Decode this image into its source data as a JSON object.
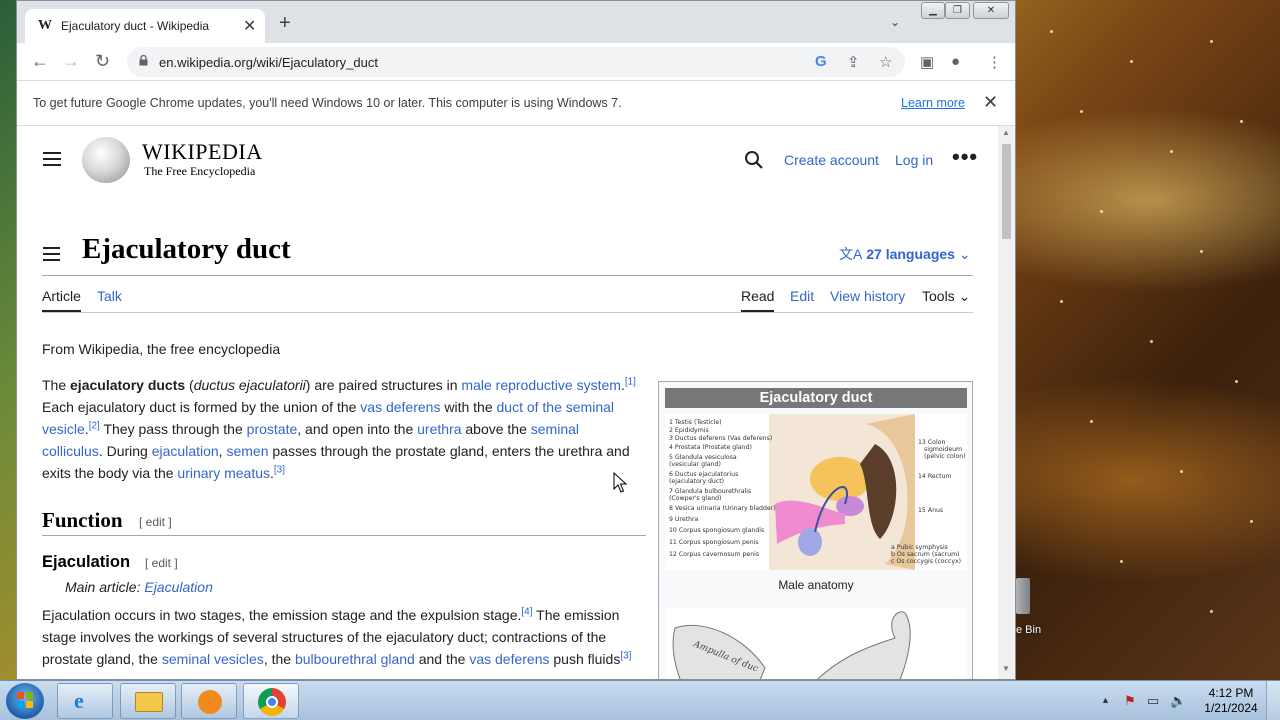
{
  "browser": {
    "tab_title": "Ejaculatory duct - Wikipedia",
    "tab_favicon": "W",
    "tab_close": "✕",
    "new_tab": "+",
    "url": "en.wikipedia.org/wiki/Ejaculatory_duct",
    "infobar_text": "To get future Google Chrome updates, you'll need Windows 10 or later. This computer is using Windows 7.",
    "infobar_link": "Learn more",
    "infobar_close": "✕"
  },
  "header": {
    "wordmark": "WIKIPEDIA",
    "tagline": "The Free Encyclopedia",
    "create_account": "Create account",
    "log_in": "Log in",
    "more": "•••"
  },
  "article": {
    "title": "Ejaculatory duct",
    "languages": "27 languages",
    "tabs": {
      "article": "Article",
      "talk": "Talk",
      "read": "Read",
      "edit": "Edit",
      "view_history": "View history",
      "tools": "Tools"
    },
    "from": "From Wikipedia, the free encyclopedia",
    "p1": {
      "t1": "The ",
      "b1": "ejaculatory ducts",
      "t2": " (",
      "i1": "ductus ejaculatorii",
      "t3": ") are paired structures in ",
      "l1": "male reproductive system",
      "t4": ".",
      "s1": "[1]",
      "t5": " Each ejaculatory duct is formed by the union of the ",
      "l2": "vas deferens",
      "t6": " with the ",
      "l3": "duct of the seminal vesicle",
      "t7": ".",
      "s2": "[2]",
      "t8": " They pass through the ",
      "l4": "prostate",
      "t9": ", and open into the ",
      "l5": "urethra",
      "t10": " above the ",
      "l6": "seminal colliculus",
      "t11": ". During ",
      "l7": "ejaculation",
      "t12": ", ",
      "l8": "semen",
      "t13": " passes through the prostate gland, enters the urethra and exits the body via the ",
      "l9": "urinary meatus",
      "t14": ".",
      "s3": "[3]"
    },
    "h2": "Function",
    "h2_edit": "[ edit ]",
    "h3": "Ejaculation",
    "h3_edit": "[ edit ]",
    "hatnote_prefix": "Main article: ",
    "hatnote_link": "Ejaculation",
    "p2": {
      "t1": "Ejaculation occurs in two stages, the emission stage and the expulsion stage.",
      "s1": "[4]",
      "t2": " The emission stage involves the workings of several structures of the ejaculatory duct; contractions of the prostate gland, the ",
      "l1": "seminal vesicles",
      "t3": ", the ",
      "l2": "bulbourethral gland",
      "t4": " and the ",
      "l3": "vas deferens",
      "t5": " push fluids",
      "s2": "[3]"
    }
  },
  "infobox": {
    "title": "Ejaculatory duct",
    "caption": "Male anatomy",
    "image_legend": [
      "1  Testis (Testicle)",
      "2  Epididymis",
      "3  Ductus deferens (Vas deferens)",
      "4  Prostata (Prostate gland)",
      "5  Glandula vesiculosa",
      "   (vesicular gland)",
      "6  Ductus ejaculatorius",
      "   (ejaculatory duct)",
      "7  Glandula bulbourethralis",
      "   (Cowper's gland)",
      "8  Vesica urinaria (Urinary bladder)",
      "9  Urethra",
      "10 Corpus spongiosum glandis",
      "11 Corpus spongiosum penis",
      "12 Corpus cavernosum penis"
    ],
    "image_right": [
      "13 Colon",
      "sigmoideum",
      "(pelvic colon)",
      "14 Rectum",
      "15 Anus",
      "a  Pubic symphysis",
      "b  Os sacrum (sacrum)",
      "c  Os coccygis (coccyx)"
    ],
    "sketch_text": "Ampulla of duc"
  },
  "desktop": {
    "recycle_label": "e Bin"
  },
  "taskbar": {
    "time": "4:12 PM",
    "date": "1/21/2024"
  },
  "colors": {
    "link": "#3366cc",
    "chrome_frame": "#dee1e6",
    "taskbar": "#b8cfe6"
  },
  "icons": [
    "back-icon",
    "forward-icon",
    "reload-icon",
    "lock-icon",
    "google-icon",
    "share-icon",
    "star-icon",
    "sidebar-icon",
    "profile-icon",
    "kebab-icon",
    "search-icon",
    "translate-icon"
  ]
}
